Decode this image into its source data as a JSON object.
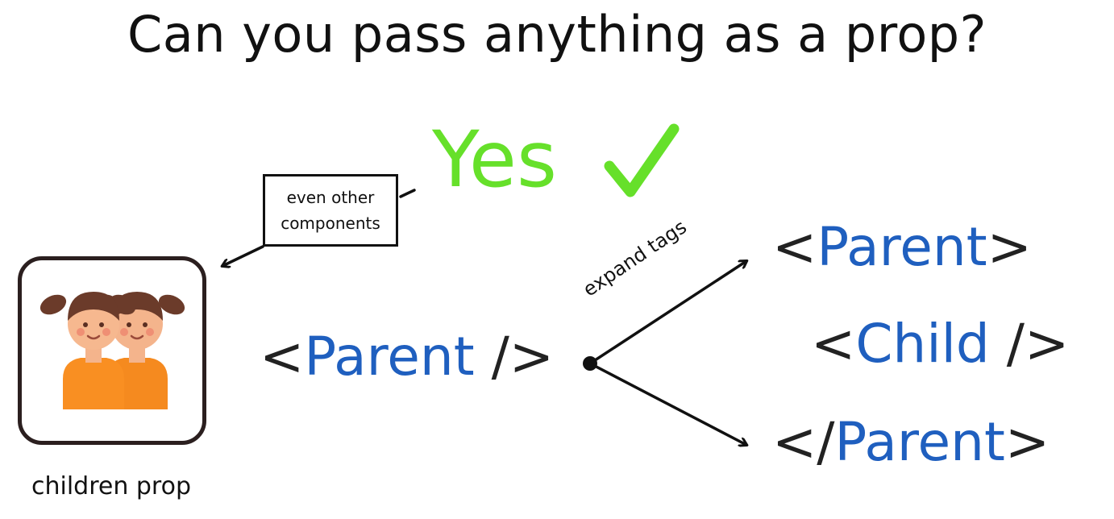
{
  "title": "Can you pass anything as a prop?",
  "answer": {
    "text": "Yes",
    "check_icon": "checkmark-icon",
    "color": "#66e02a"
  },
  "note": {
    "line1": "even other",
    "line2": "components"
  },
  "avatar": {
    "icon": "twin-girls-icon",
    "caption": "children prop"
  },
  "code_self_closing": {
    "open": "<",
    "name": "Parent",
    "close": " />"
  },
  "expand_label": "expand tags",
  "expanded": {
    "open_tag": {
      "open": "<",
      "name": "Parent",
      "close": ">"
    },
    "child_tag": {
      "open": "<",
      "name": "Child",
      "close": " />"
    },
    "close_tag": {
      "open": "</",
      "name": "Parent",
      "close": ">"
    }
  },
  "colors": {
    "tag_name": "#1f5fbf",
    "bracket": "#222222",
    "yes_green": "#66e02a",
    "hair": "#6b3b2a",
    "skin": "#f4b48c",
    "shirt": "#f58a1f"
  }
}
